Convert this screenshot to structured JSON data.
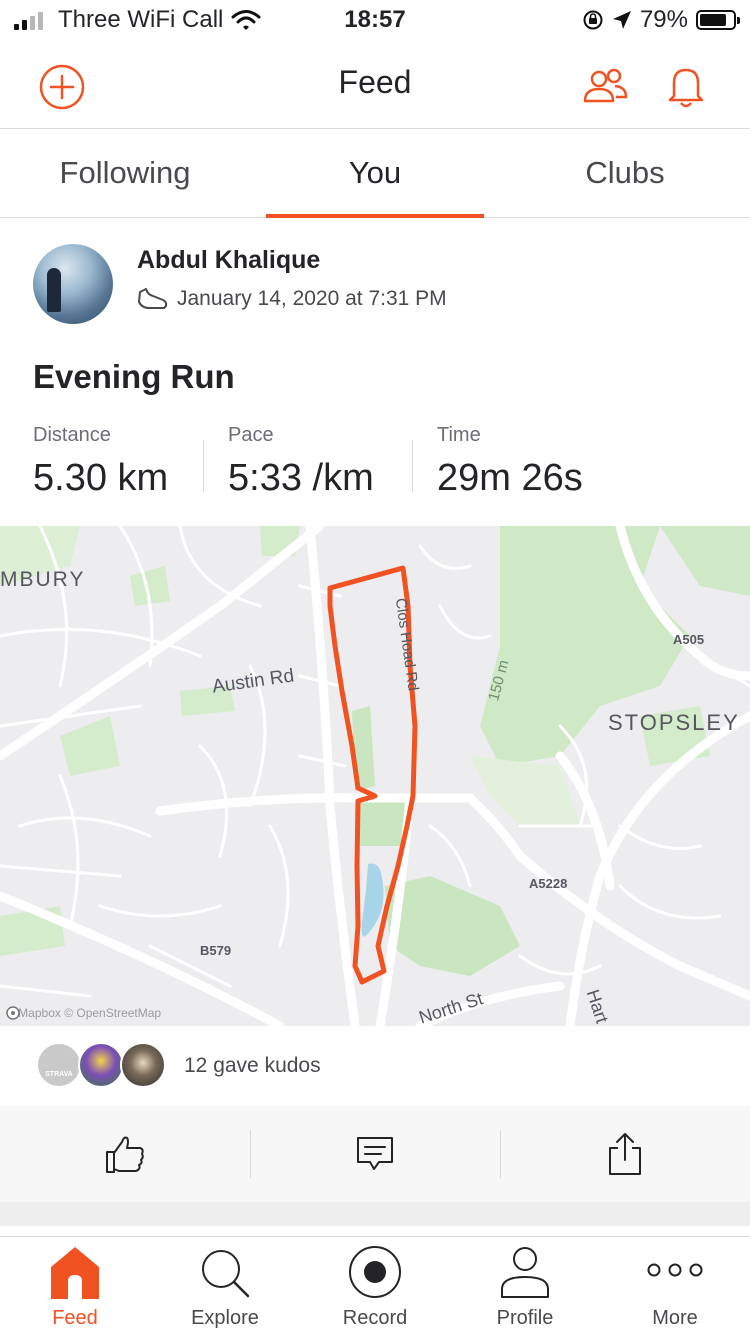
{
  "status_bar": {
    "carrier": "Three WiFi Call",
    "time": "18:57",
    "battery": "79%",
    "battery_level": 0.79
  },
  "header": {
    "title": "Feed",
    "add_icon": "plus-circle-icon",
    "people_icon": "people-icon",
    "bell_icon": "bell-icon"
  },
  "tabs": [
    {
      "label": "Following",
      "active": false
    },
    {
      "label": "You",
      "active": true
    },
    {
      "label": "Clubs",
      "active": false
    }
  ],
  "activity": {
    "athlete": "Abdul Khalique",
    "date": "January 14, 2020 at 7:31 PM",
    "sport_icon": "shoe-icon",
    "title": "Evening Run",
    "stats": [
      {
        "label": "Distance",
        "value": "5.30 km"
      },
      {
        "label": "Pace",
        "value": "5:33 /km"
      },
      {
        "label": "Time",
        "value": "29m 26s"
      }
    ]
  },
  "map": {
    "labels": {
      "ambury": "MBURY",
      "austin": "Austin Rd",
      "a505": "A505",
      "stopsley": "STOPSLEY",
      "contour": "150 m",
      "a5228": "A5228",
      "b579": "B579",
      "north": "North St",
      "hart": "Hart",
      "clos": "Clos Hoad Rd"
    },
    "attribution": "© Mapbox © OpenStreetMap",
    "route_color": "#f05222",
    "park_color": "#c9e6c0"
  },
  "kudos": {
    "text": "12 gave kudos",
    "first_avatar_text": "STRAVA"
  },
  "actions": {
    "kudos_icon": "thumbs-up-icon",
    "comment_icon": "comment-icon",
    "share_icon": "share-icon"
  },
  "nav": [
    {
      "label": "Feed",
      "icon": "home-icon",
      "active": true
    },
    {
      "label": "Explore",
      "icon": "search-icon",
      "active": false
    },
    {
      "label": "Record",
      "icon": "record-icon",
      "active": false
    },
    {
      "label": "Profile",
      "icon": "profile-icon",
      "active": false
    },
    {
      "label": "More",
      "icon": "more-icon",
      "active": false
    }
  ],
  "colors": {
    "accent": "#f05222",
    "text": "#242428",
    "muted": "#6d6d78"
  }
}
